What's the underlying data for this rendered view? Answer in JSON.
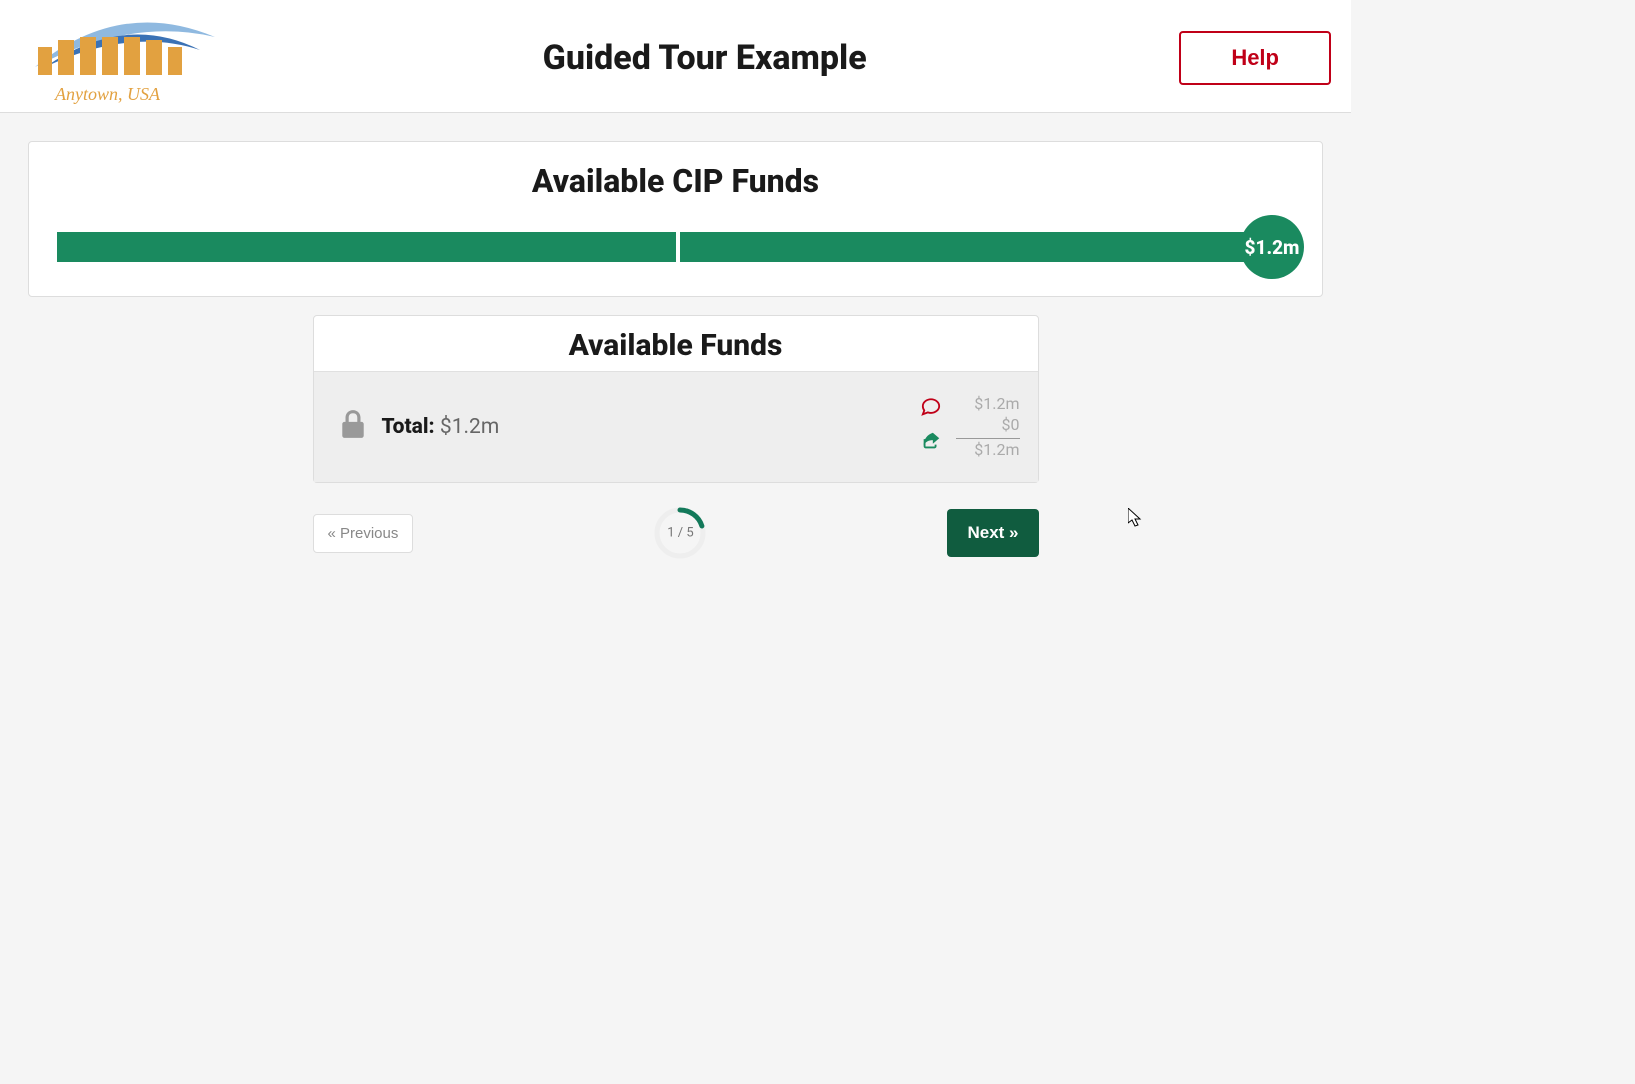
{
  "header": {
    "logo_subtitle": "Anytown, USA",
    "title": "Guided Tour Example",
    "help_label": "Help"
  },
  "cip_card": {
    "title": "Available CIP Funds",
    "badge_value": "$1.2m"
  },
  "funds_card": {
    "title": "Available Funds",
    "total_label": "Total:",
    "total_value": "$1.2m",
    "amounts": {
      "top": "$1.2m",
      "mid": "$0",
      "bottom": "$1.2m"
    }
  },
  "nav": {
    "prev_label": "« Previous",
    "progress_text": "1 / 5",
    "next_label": "Next »"
  }
}
